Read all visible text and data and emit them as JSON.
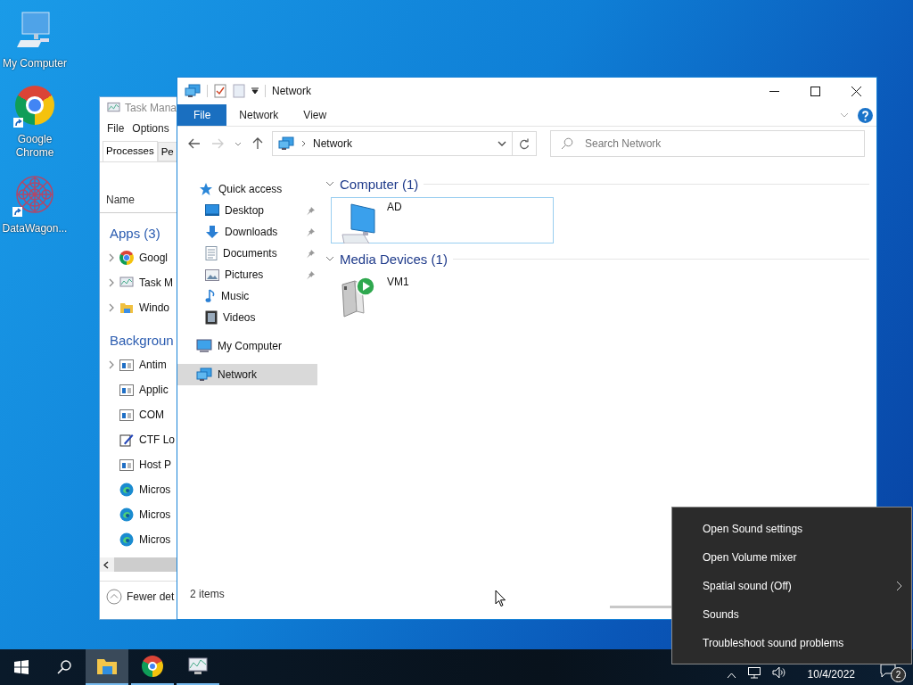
{
  "desktop_icons": [
    {
      "label": "My Computer",
      "kind": "computer",
      "shortcut": false
    },
    {
      "label": "Google Chrome",
      "kind": "chrome",
      "shortcut": true
    },
    {
      "label": "DataWagon...",
      "kind": "mandala",
      "shortcut": true
    }
  ],
  "task_manager": {
    "title": "Task Mana",
    "menu": [
      "File",
      "Options"
    ],
    "tabs": [
      {
        "label": "Processes",
        "selected": true
      },
      {
        "label": "Pe",
        "selected": false
      }
    ],
    "column": "Name",
    "footer": "Fewer det",
    "groups": [
      {
        "title": "Apps (3)",
        "rows": [
          {
            "name": "Googl",
            "kind": "chrome",
            "expandable": true
          },
          {
            "name": "Task M",
            "kind": "taskmgr",
            "expandable": true
          },
          {
            "name": "Windo",
            "kind": "folder",
            "expandable": true
          }
        ]
      },
      {
        "title": "Backgroun",
        "rows": [
          {
            "name": "Antim",
            "kind": "service",
            "expandable": true
          },
          {
            "name": "Applic",
            "kind": "service",
            "expandable": false
          },
          {
            "name": "COM",
            "kind": "service",
            "expandable": false
          },
          {
            "name": "CTF Lo",
            "kind": "ctf",
            "expandable": false
          },
          {
            "name": "Host P",
            "kind": "service",
            "expandable": false
          },
          {
            "name": "Micros",
            "kind": "edge",
            "expandable": false
          },
          {
            "name": "Micros",
            "kind": "edge",
            "expandable": false
          },
          {
            "name": "Micros",
            "kind": "edge",
            "expandable": false
          }
        ]
      }
    ]
  },
  "explorer": {
    "title": "Network",
    "ribbon_tabs": [
      {
        "label": "File",
        "selected": true
      },
      {
        "label": "Network",
        "selected": false
      },
      {
        "label": "View",
        "selected": false
      }
    ],
    "address": "Network",
    "search": {
      "placeholder": "Search Network"
    },
    "nav": [
      {
        "label": "Quick access",
        "kind": "star",
        "selected": false,
        "children": [
          {
            "label": "Desktop",
            "kind": "desktop",
            "pinned": true,
            "selected": false
          },
          {
            "label": "Downloads",
            "kind": "download",
            "pinned": true,
            "selected": false
          },
          {
            "label": "Documents",
            "kind": "document",
            "pinned": true,
            "selected": false
          },
          {
            "label": "Pictures",
            "kind": "pictures",
            "pinned": true,
            "selected": false
          },
          {
            "label": "Music",
            "kind": "music",
            "pinned": false,
            "selected": false
          },
          {
            "label": "Videos",
            "kind": "video",
            "pinned": false,
            "selected": false
          }
        ]
      },
      {
        "label": "My Computer",
        "kind": "computer",
        "selected": false
      },
      {
        "label": "Network",
        "kind": "network",
        "selected": true
      }
    ],
    "groups": [
      {
        "title": "Computer (1)",
        "items": [
          {
            "name": "AD",
            "kind": "computer",
            "selected": true
          }
        ]
      },
      {
        "title": "Media Devices (1)",
        "items": [
          {
            "name": "VM1",
            "kind": "media",
            "selected": false
          }
        ]
      }
    ],
    "status": "2 items"
  },
  "context_menu": [
    {
      "label": "Open Sound settings",
      "submenu": false
    },
    {
      "label": "Open Volume mixer",
      "submenu": false
    },
    {
      "label": "Spatial sound (Off)",
      "submenu": true
    },
    {
      "label": "Sounds",
      "submenu": false
    },
    {
      "label": "Troubleshoot sound problems",
      "submenu": false
    }
  ],
  "taskbar": {
    "apps": [
      {
        "kind": "explorer",
        "active": true
      },
      {
        "kind": "chrome",
        "active": false
      },
      {
        "kind": "taskmgr",
        "active": false
      }
    ],
    "date": "10/4/2022",
    "notifications": "2"
  }
}
